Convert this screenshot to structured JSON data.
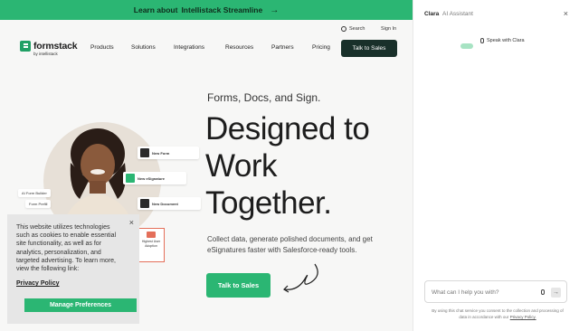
{
  "banner": {
    "lead": "Learn about",
    "link": "Intellistack Streamline",
    "arrow": "→"
  },
  "header": {
    "utility": {
      "search": "Search",
      "signin": "Sign In"
    },
    "logo": {
      "name": "formstack",
      "byline": "by intellistack"
    },
    "nav": [
      "Products",
      "Solutions",
      "Integrations",
      "Resources",
      "Partners",
      "Pricing"
    ],
    "cta": "Talk to Sales"
  },
  "hero": {
    "kicker": "Forms, Docs, and Sign.",
    "title_lines": [
      "Designed to",
      "Work",
      "Together."
    ],
    "description": "Collect data, generate polished documents, and get eSignatures faster with Salesforce-ready tools.",
    "cta": "Talk to Sales"
  },
  "illustration": {
    "chips": [
      {
        "label": "New Form"
      },
      {
        "label": "New eSignature"
      },
      {
        "label": "New Document"
      }
    ],
    "tags": [
      "AI Form Builder",
      "Form Prefill"
    ],
    "badge": "Highest User Adoption"
  },
  "cookie": {
    "text": "This website utilizes technologies such as cookies to enable essential site functionality, as well as for analytics, personalization, and targeted advertising. To learn more, view the following link:",
    "policy": "Privacy Policy",
    "manage": "Manage Preferences",
    "close": "×"
  },
  "assistant": {
    "name": "Clara",
    "subtitle": "AI Assistant",
    "close": "×",
    "speak": "Speak with Clara",
    "placeholder": "What can I help you with?",
    "disclaimer_pre": "By using this chat service you consent to the collection and processing of data in accordance with our",
    "disclaimer_link": "Privacy Policy."
  },
  "colors": {
    "brand_green": "#2bb673",
    "dark_cta": "#19302a"
  }
}
